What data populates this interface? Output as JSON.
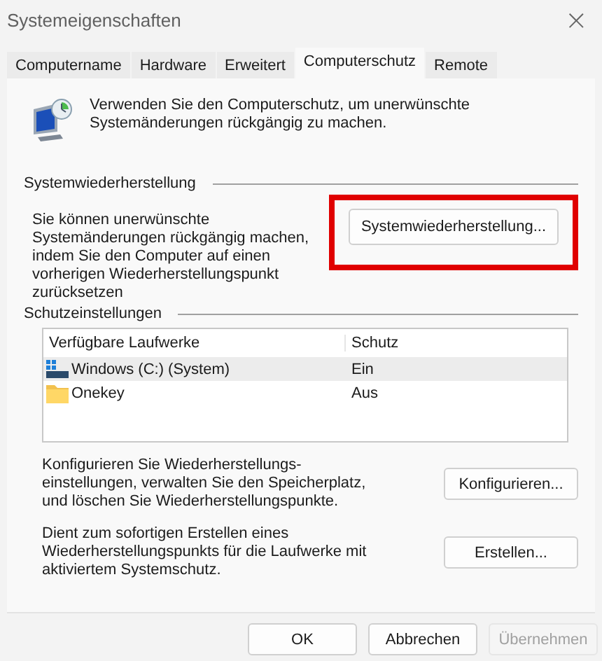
{
  "window": {
    "title": "Systemeigenschaften",
    "close": "×"
  },
  "tabs": [
    {
      "label": "Computername",
      "selected": false
    },
    {
      "label": "Hardware",
      "selected": false
    },
    {
      "label": "Erweitert",
      "selected": false
    },
    {
      "label": "Computerschutz",
      "selected": true
    },
    {
      "label": "Remote",
      "selected": false
    }
  ],
  "intro": "Verwenden Sie den Computerschutz, um unerwünschte Systemänderungen rückgängig zu machen.",
  "restore": {
    "heading": "Systemwiederherstellung",
    "text": "Sie können unerwünschte Systemänderungen rückgängig machen, indem Sie den Computer auf einen vorherigen Wiederherstellungspunkt zurücksetzen",
    "button": {
      "label": "Systemwiederherstellung...",
      "highlighted": true
    }
  },
  "protection": {
    "heading": "Schutzeinstellungen",
    "columns": [
      "Verfügbare Laufwerke",
      "Schutz"
    ],
    "rows": [
      {
        "kind": "system-drive",
        "name": "Windows (C:) (System)",
        "status": "Ein",
        "selected": true
      },
      {
        "kind": "folder",
        "name": "Onekey",
        "status": "Aus",
        "selected": false
      }
    ],
    "actions": [
      {
        "text": "Konfigurieren Sie Wiederherstellungs-einstellungen, verwalten Sie den Speicherplatz, und löschen Sie Wiederherstellungspunkte.",
        "button": "Konfigurieren..."
      },
      {
        "text": "Dient zum sofortigen Erstellen eines Wiederherstellungspunkts für die Laufwerke mit aktiviertem Systemschutz.",
        "button": "Erstellen..."
      }
    ]
  },
  "buttons": [
    {
      "label": "OK",
      "disabled": false
    },
    {
      "label": "Abbrechen",
      "disabled": false
    },
    {
      "label": "Übernehmen",
      "disabled": true
    }
  ]
}
